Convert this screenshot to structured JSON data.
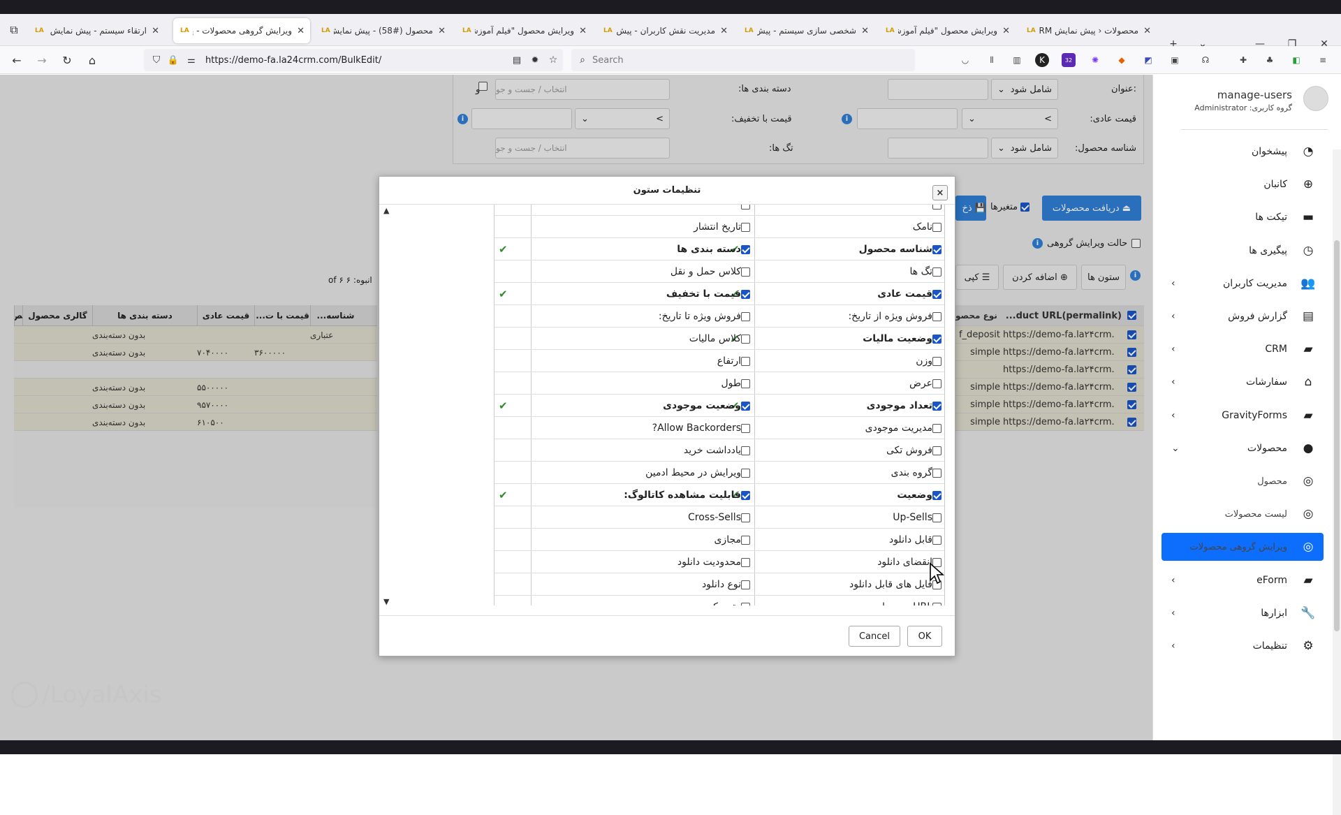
{
  "browser": {
    "tabs": [
      {
        "title": "ارتقاء سیستم - پیش نمایش",
        "active": false
      },
      {
        "title": "ویرایش گروهی محصولات - پیش",
        "active": true
      },
      {
        "title": "محصول (#58) - پیش نمایش",
        "active": false
      },
      {
        "title": "ویرایش محصول \"فیلم آموزشی پ",
        "active": false
      },
      {
        "title": "مدیریت نقش کاربران - پیش",
        "active": false
      },
      {
        "title": "شخصی سازی سیستم - پیش",
        "active": false
      },
      {
        "title": "ویرایش محصول \"فیلم آموزشی پ",
        "active": false
      },
      {
        "title": "محصولات ‹ پیش نمایش CRM",
        "active": false
      }
    ],
    "url_prefix": "https://demo-fa.",
    "url_domain": "la24crm.com",
    "url_path": "/BulkEdit/",
    "search_placeholder": "Search",
    "ext_badge": "32"
  },
  "filters": {
    "title_label": "عنوان:",
    "title_op": "شامل شود",
    "categories_label": "دسته بندی ها:",
    "categories_placeholder": "انتخاب / جست و جو",
    "and_label": "و",
    "regular_price_label": "قیمت عادی:",
    "sale_price_label": "قیمت با تخفیف:",
    "tags_label": "تگ ها:",
    "tags_placeholder": "انتخاب / جست و جو",
    "product_id_label": "شناسه محصول:",
    "product_id_op": "شامل شود",
    "gt_symbol": ">"
  },
  "toolbar": {
    "get_products": "دریافت محصولات",
    "variations": "متغیرها",
    "save": "ذخ",
    "group_edit_mode": "حالت ویرایش گروهی",
    "columns": "ستون ها",
    "add": "اضافه کردن",
    "copy": "کپی",
    "count_text": "انبوه: ۶ of ۶"
  },
  "grid": {
    "headers": [
      "شناسه...",
      "قیمت با ت...",
      "قیمت عادی",
      "دسته بندی ها",
      "گالری محصول",
      "تص"
    ],
    "rows": [
      {
        "id": "عتباری",
        "sale": "",
        "regular": "",
        "cat": "بدون دسته‌بندی"
      },
      {
        "id": "",
        "sale": "۳۶۰۰۰۰۰",
        "regular": "۷۰۴۰۰۰۰",
        "cat": "بدون دسته‌بندی"
      },
      {
        "id": "",
        "sale": "",
        "regular": "",
        "cat": ""
      },
      {
        "id": "",
        "sale": "",
        "regular": "۵۵۰۰۰۰۰",
        "cat": "بدون دسته‌بندی"
      },
      {
        "id": "",
        "sale": "",
        "regular": "۹۵۷۰۰۰۰",
        "cat": "بدون دسته‌بندی"
      },
      {
        "id": "",
        "sale": "",
        "regular": "۶۱۰۵۰۰",
        "cat": "بدون دسته‌بندی"
      }
    ],
    "right_headers": [
      "...duct URL(permalink)",
      "نوع محصو"
    ],
    "right_rows": [
      {
        "url": "https://demo-fa.la۲۴crm.",
        "type": "f_deposit"
      },
      {
        "url": "https://demo-fa.la۲۴crm.",
        "type": "simple"
      },
      {
        "url": "https://demo-fa.la۲۴crm.",
        "type": ""
      },
      {
        "url": "https://demo-fa.la۲۴crm.",
        "type": "simple"
      },
      {
        "url": "https://demo-fa.la۲۴crm.",
        "type": "simple"
      },
      {
        "url": "https://demo-fa.la۲۴crm.",
        "type": "simple"
      }
    ]
  },
  "modal": {
    "title": "تنظیمات ستون",
    "close": "×",
    "rows": [
      {
        "right": "",
        "right_on": false,
        "left": "",
        "left_on": false,
        "tick_a": false,
        "tick_b": false
      },
      {
        "right": "نامک",
        "right_on": false,
        "left": "تاریخ انتشار",
        "left_on": false,
        "tick_a": false,
        "tick_b": false
      },
      {
        "right": "شناسه محصول",
        "right_on": true,
        "left": "دسته بندی ها",
        "left_on": true,
        "tick_a": true,
        "tick_b": true
      },
      {
        "right": "تگ ها",
        "right_on": false,
        "left": "کلاس حمل و نقل",
        "left_on": false,
        "tick_a": false,
        "tick_b": false
      },
      {
        "right": "قیمت عادی",
        "right_on": true,
        "left": "قیمت با تخفیف",
        "left_on": true,
        "tick_a": true,
        "tick_b": true
      },
      {
        "right": "فروش ویژه از تاریخ:",
        "right_on": false,
        "left": "فروش ویژه تا تاریخ:",
        "left_on": false,
        "tick_a": false,
        "tick_b": false
      },
      {
        "right": "وضعیت مالیات",
        "right_on": true,
        "left": "کلاس مالیات",
        "left_on": false,
        "tick_a": true,
        "tick_b": false
      },
      {
        "right": "وزن",
        "right_on": false,
        "left": "ارتفاع",
        "left_on": false,
        "tick_a": false,
        "tick_b": false
      },
      {
        "right": "عرض",
        "right_on": false,
        "left": "طول",
        "left_on": false,
        "tick_a": false,
        "tick_b": false
      },
      {
        "right": "تعداد موجودی",
        "right_on": true,
        "left": "وضعیت موجودی",
        "left_on": true,
        "tick_a": true,
        "tick_b": true
      },
      {
        "right": "مدیریت موجودی",
        "right_on": false,
        "left": "Allow Backorders?",
        "left_on": false,
        "tick_a": false,
        "tick_b": false
      },
      {
        "right": "فروش تکی",
        "right_on": false,
        "left": "یادداشت خرید",
        "left_on": false,
        "tick_a": false,
        "tick_b": false
      },
      {
        "right": "گروه بندی",
        "right_on": false,
        "left": "ویرایش در محیط ادمین",
        "left_on": false,
        "tick_a": false,
        "tick_b": false
      },
      {
        "right": "وضعیت",
        "right_on": true,
        "left": "قابلیت مشاهده کاتالوگ:",
        "left_on": true,
        "tick_a": true,
        "tick_b": true
      },
      {
        "right": "Up-Sells",
        "right_on": false,
        "left": "Cross-Sells",
        "left_on": false,
        "tick_a": false,
        "tick_b": false
      },
      {
        "right": "قابل دانلود",
        "right_on": false,
        "left": "مجازی",
        "left_on": false,
        "tick_a": false,
        "tick_b": false
      },
      {
        "right": "انقضای دانلود",
        "right_on": false,
        "left": "محدودیت دانلود",
        "left_on": false,
        "tick_a": false,
        "tick_b": false
      },
      {
        "right": "فایل های قابل دانلود",
        "right_on": false,
        "left": "نوع دانلود",
        "left_on": false,
        "tick_a": false,
        "tick_b": false
      },
      {
        "right": "URL محصول",
        "right_on": false,
        "left": "متن دکمه",
        "left_on": false,
        "tick_a": false,
        "tick_b": false
      }
    ],
    "ok": "OK",
    "cancel": "Cancel",
    "tick_glyph": "✔"
  },
  "sidebar": {
    "user_name": "manage-users",
    "user_group": "گروه کاربری: Administrator",
    "items": [
      {
        "label": "پیشخوان",
        "icon": "dashboard-icon",
        "glyph": "◔",
        "chevron": false,
        "active": false,
        "sub": false
      },
      {
        "label": "کانبان",
        "icon": "kanban-icon",
        "glyph": "⊕",
        "chevron": false,
        "active": false,
        "sub": false
      },
      {
        "label": "تیکت ها",
        "icon": "ticket-icon",
        "glyph": "▬",
        "chevron": false,
        "active": false,
        "sub": false
      },
      {
        "label": "پیگیری ها",
        "icon": "clock-icon",
        "glyph": "◷",
        "chevron": false,
        "active": false,
        "sub": false
      },
      {
        "label": "مدیریت کاربران",
        "icon": "users-icon",
        "glyph": "👥",
        "chevron": true,
        "active": false,
        "sub": false
      },
      {
        "label": "گزارش فروش",
        "icon": "report-icon",
        "glyph": "▤",
        "chevron": true,
        "active": false,
        "sub": false
      },
      {
        "label": "CRM",
        "icon": "folder-open-icon",
        "glyph": "▰",
        "chevron": true,
        "active": false,
        "sub": false
      },
      {
        "label": "سفارشات",
        "icon": "basket-icon",
        "glyph": "⌂",
        "chevron": true,
        "active": false,
        "sub": false
      },
      {
        "label": "GravityForms",
        "icon": "folder-icon",
        "glyph": "▰",
        "chevron": true,
        "active": false,
        "sub": false
      },
      {
        "label": "محصولات",
        "icon": "product-icon",
        "glyph": "●",
        "chevron": true,
        "active": false,
        "sub": false
      },
      {
        "label": "محصول",
        "icon": "circle-icon",
        "glyph": "◎",
        "chevron": false,
        "active": false,
        "sub": true
      },
      {
        "label": "لیست محصولات",
        "icon": "circle-icon",
        "glyph": "◎",
        "chevron": false,
        "active": false,
        "sub": true
      },
      {
        "label": "ویرایش گروهی محصولات",
        "icon": "circle-icon",
        "glyph": "◎",
        "chevron": false,
        "active": true,
        "sub": true
      },
      {
        "label": "eForm",
        "icon": "folder-icon",
        "glyph": "▰",
        "chevron": true,
        "active": false,
        "sub": false
      },
      {
        "label": "ابزارها",
        "icon": "wrench-icon",
        "glyph": "🔧",
        "chevron": true,
        "active": false,
        "sub": false
      },
      {
        "label": "تنظیمات",
        "icon": "gear-icon",
        "glyph": "⚙",
        "chevron": true,
        "active": false,
        "sub": false
      }
    ]
  },
  "watermark": "/LoyalAxis",
  "colors": {
    "primary": "#2f7fd6",
    "active_nav": "#0d6efd",
    "check_green": "#2e8b2e"
  }
}
